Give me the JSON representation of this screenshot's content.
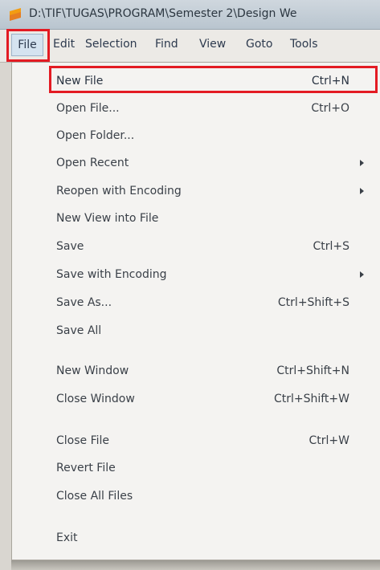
{
  "window": {
    "title": "D:\\TIF\\TUGAS\\PROGRAM\\Semester 2\\Design We"
  },
  "menubar": {
    "items": [
      {
        "label": "File",
        "active": true
      },
      {
        "label": "Edit"
      },
      {
        "label": "Selection"
      },
      {
        "label": "Find"
      },
      {
        "label": "View"
      },
      {
        "label": "Goto"
      },
      {
        "label": "Tools"
      }
    ]
  },
  "file_menu": {
    "items": [
      {
        "label": "New File",
        "shortcut": "Ctrl+N"
      },
      {
        "label": "Open File...",
        "shortcut": "Ctrl+O"
      },
      {
        "label": "Open Folder...",
        "shortcut": ""
      },
      {
        "label": "Open Recent",
        "shortcut": "",
        "submenu": true
      },
      {
        "label": "Reopen with Encoding",
        "shortcut": "",
        "submenu": true
      },
      {
        "label": "New View into File",
        "shortcut": ""
      },
      {
        "label": "Save",
        "shortcut": "Ctrl+S"
      },
      {
        "label": "Save with Encoding",
        "shortcut": "",
        "submenu": true
      },
      {
        "label": "Save As...",
        "shortcut": "Ctrl+Shift+S"
      },
      {
        "label": "Save All",
        "shortcut": ""
      },
      {
        "label": "New Window",
        "shortcut": "Ctrl+Shift+N"
      },
      {
        "label": "Close Window",
        "shortcut": "Ctrl+Shift+W"
      },
      {
        "label": "Close File",
        "shortcut": "Ctrl+W"
      },
      {
        "label": "Revert File",
        "shortcut": ""
      },
      {
        "label": "Close All Files",
        "shortcut": ""
      },
      {
        "label": "Exit",
        "shortcut": ""
      }
    ]
  },
  "colors": {
    "highlight": "#e31b23",
    "menu_bg": "#f4f3f1",
    "text": "#3a4048"
  }
}
